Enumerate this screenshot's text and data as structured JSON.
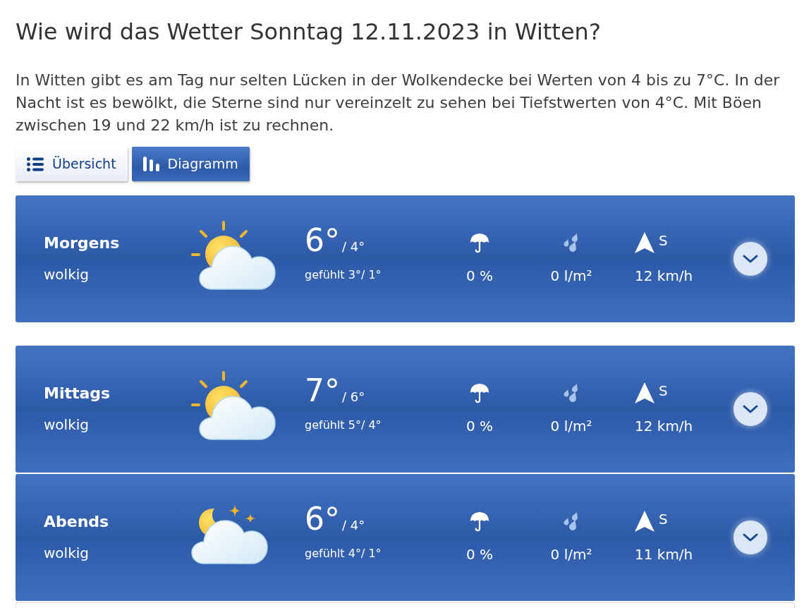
{
  "heading": "Wie wird das Wetter Sonntag 12.11.2023 in Witten?",
  "summary": "In Witten gibt es am Tag nur selten Lücken in der Wolkendecke bei Werten von 4 bis zu 7°C. In der Nacht ist es bewölkt, die Sterne sind nur vereinzelt zu sehen bei Tiefstwerten von 4°C. Mit Böen zwischen 19 und 22 km/h ist zu rechnen.",
  "view_tabs": [
    {
      "kind": "overview",
      "label": "Übersicht",
      "selected": false
    },
    {
      "kind": "diagram",
      "label": "Diagramm",
      "selected": true
    }
  ],
  "periods": [
    {
      "kind": "day",
      "name": "Morgens",
      "condition": "wolkig",
      "temp_max": "6°",
      "temp_min": "/ 4°",
      "feels_like": "gefühlt 3°/ 1°",
      "rain_probability": "0 %",
      "rain_amount": "0 l/m²",
      "wind_direction": "S",
      "wind_speed": "12 km/h",
      "expanded": false
    },
    {
      "kind": "day",
      "name": "Mittags",
      "condition": "wolkig",
      "temp_max": "7°",
      "temp_min": "/ 6°",
      "feels_like": "gefühlt 5°/ 4°",
      "rain_probability": "0 %",
      "rain_amount": "0 l/m²",
      "wind_direction": "S",
      "wind_speed": "12 km/h",
      "expanded": false
    },
    {
      "kind": "night",
      "name": "Abends",
      "condition": "wolkig",
      "temp_max": "6°",
      "temp_min": "/ 4°",
      "feels_like": "gefühlt 4°/ 1°",
      "rain_probability": "0 %",
      "rain_amount": "0 l/m²",
      "wind_direction": "S",
      "wind_speed": "11 km/h",
      "expanded": false
    }
  ]
}
